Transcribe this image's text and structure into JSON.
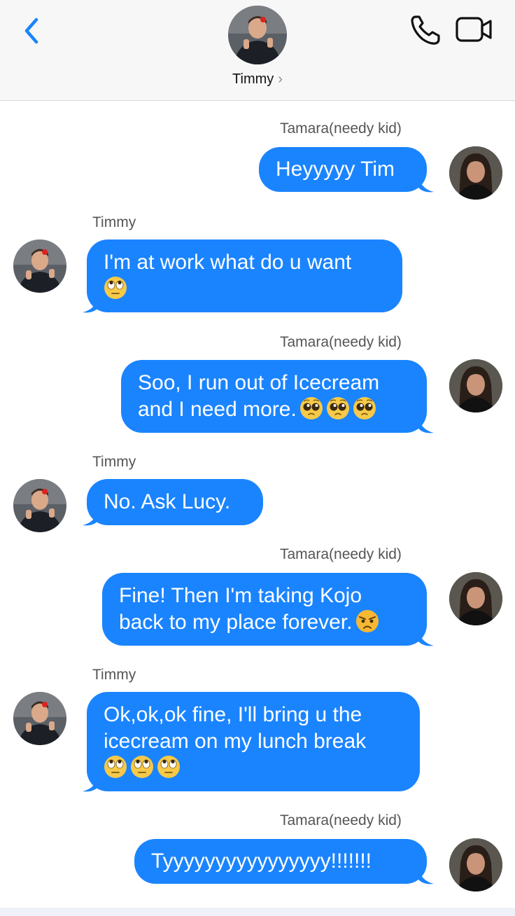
{
  "header": {
    "contact_name": "Timmy",
    "chevron": "›",
    "back_icon": "chevron-left-icon",
    "call_icon": "phone-icon",
    "video_icon": "video-camera-icon",
    "accent_color": "#1a84ff"
  },
  "messages": [
    {
      "sender": "Tamara(needy kid)",
      "direction": "outgoing",
      "text": "Heyyyyy Tim",
      "emojis": []
    },
    {
      "sender": "Timmy",
      "direction": "incoming",
      "text": "I'm at work what do u want",
      "emojis": [
        "eye-roll"
      ]
    },
    {
      "sender": "Tamara(needy kid)",
      "direction": "outgoing",
      "text": "Soo, I run out of Icecream\nand I need more.",
      "emojis": [
        "pleading",
        "pleading",
        "pleading"
      ]
    },
    {
      "sender": "Timmy",
      "direction": "incoming",
      "text": "No. Ask Lucy.",
      "emojis": []
    },
    {
      "sender": "Tamara(needy kid)",
      "direction": "outgoing",
      "text": "Fine! Then I'm taking Kojo\nback to my place forever.",
      "emojis": [
        "angry"
      ]
    },
    {
      "sender": "Timmy",
      "direction": "incoming",
      "text": "Ok,ok,ok fine, I'll bring u the\nicecream on my lunch break",
      "emojis": [
        "eye-roll",
        "eye-roll",
        "eye-roll"
      ]
    },
    {
      "sender": "Tamara(needy kid)",
      "direction": "outgoing",
      "text": "Tyyyyyyyyyyyyyyyy!!!!!!!",
      "emojis": []
    }
  ]
}
